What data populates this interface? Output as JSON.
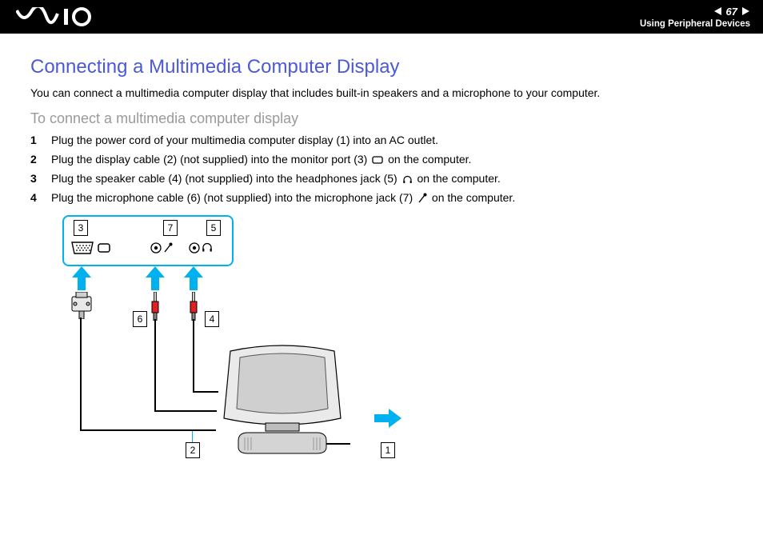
{
  "header": {
    "page_number": "67",
    "section": "Using Peripheral Devices"
  },
  "title": "Connecting a Multimedia Computer Display",
  "intro": "You can connect a multimedia computer display that includes built-in speakers and a microphone to your computer.",
  "subhead": "To connect a multimedia computer display",
  "steps": [
    {
      "n": "1",
      "text_a": "Plug the power cord of your multimedia computer display (1) into an AC outlet.",
      "icon": ""
    },
    {
      "n": "2",
      "text_a": "Plug the display cable (2) (not supplied) into the monitor port (3) ",
      "icon": "monitor",
      "text_b": " on the computer."
    },
    {
      "n": "3",
      "text_a": "Plug the speaker cable (4) (not supplied) into the headphones jack (5) ",
      "icon": "headphones",
      "text_b": " on the computer."
    },
    {
      "n": "4",
      "text_a": "Plug the microphone cable (6) (not supplied) into the microphone jack (7) ",
      "icon": "mic",
      "text_b": " on the computer."
    }
  ],
  "diagram": {
    "callouts": {
      "c1": "1",
      "c2": "2",
      "c3": "3",
      "c4": "4",
      "c5": "5",
      "c6": "6",
      "c7": "7"
    }
  }
}
